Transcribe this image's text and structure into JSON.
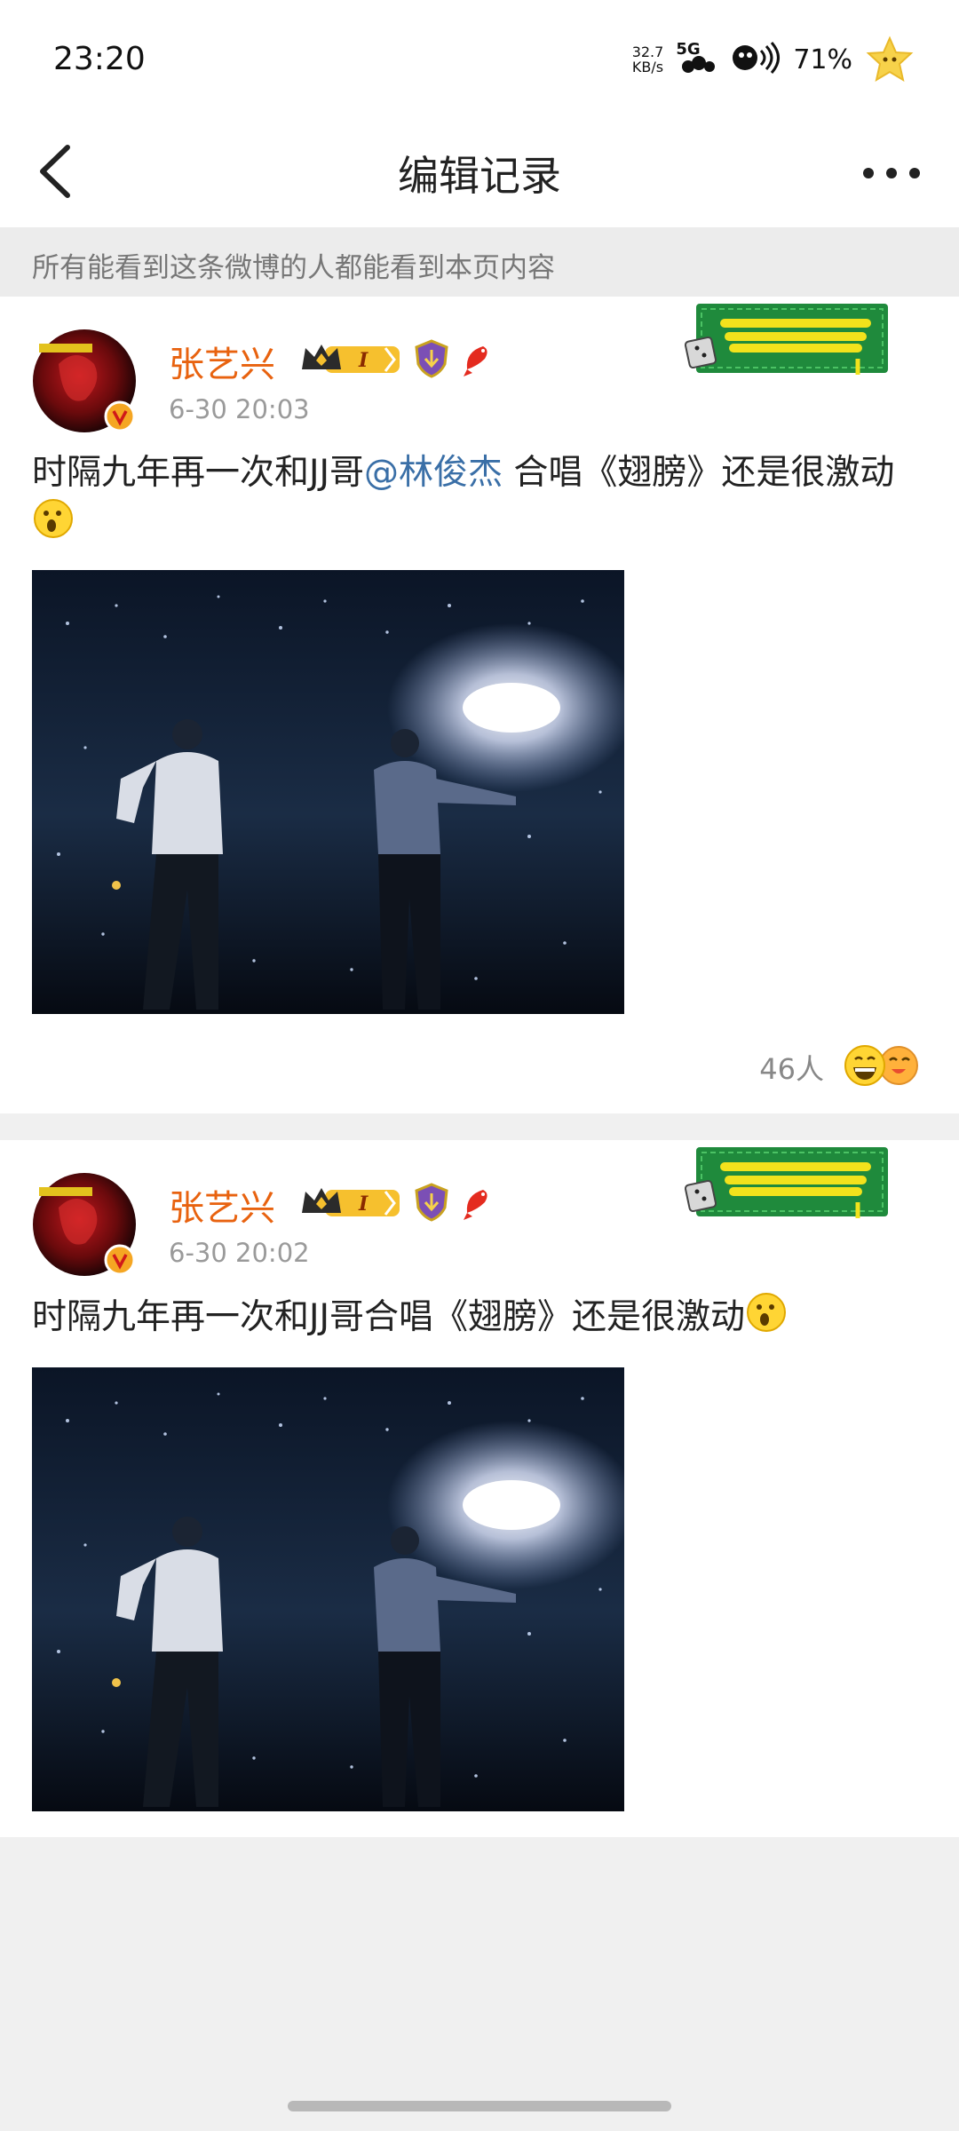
{
  "status_bar": {
    "time": "23:20",
    "net_speed_value": "32.7",
    "net_speed_unit": "KB/s",
    "network": "5G",
    "battery": "71%"
  },
  "nav": {
    "title": "编辑记录",
    "back_icon": "chevron-left-icon",
    "more_icon": "more-dots-icon"
  },
  "notice": "所有能看到这条微博的人都能看到本页内容",
  "posts": [
    {
      "username": "张艺兴",
      "time": "6-30 20:03",
      "text_before": "时隔九年再一次和JJ哥",
      "mention": "@林俊杰",
      "text_after": " 合唱《翅膀》还是很激动",
      "reaction_count": "46人"
    },
    {
      "username": "张艺兴",
      "time": "6-30 20:02",
      "text": "时隔九年再一次和JJ哥合唱《翅膀》还是很激动"
    }
  ],
  "colors": {
    "username": "#e8620f",
    "mention": "#3a6fa7",
    "sticker_green": "#1f8a3c",
    "sticker_yellow": "#f2e21c"
  }
}
